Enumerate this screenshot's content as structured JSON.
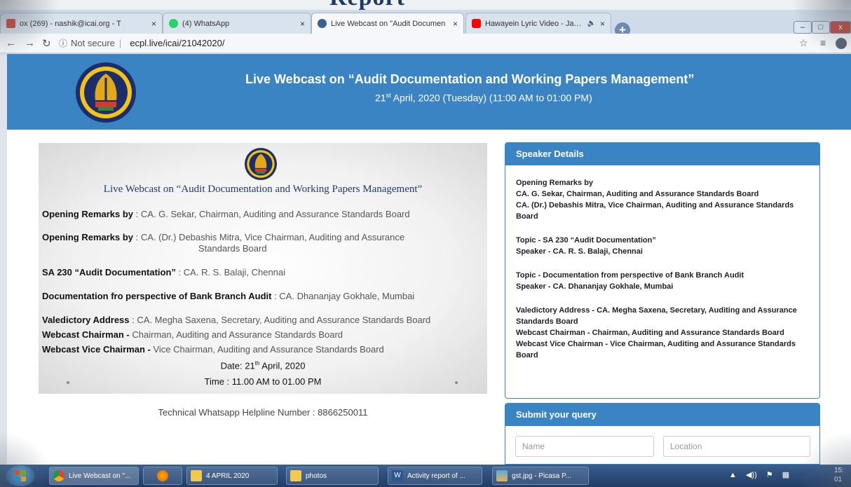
{
  "top_caption": "Report",
  "tabs": [
    {
      "label": "ox (269) - nashik@icai.org - T",
      "color": "#d44638"
    },
    {
      "label": "(4) WhatsApp",
      "color": "#25d366"
    },
    {
      "label": "Live Webcast on \"Audit Documen",
      "color": "#3b5f8f"
    },
    {
      "label": "Hawayein Lyric Video - Jab H",
      "color": "#ff0000"
    }
  ],
  "tab_close": "×",
  "browser": {
    "security": "Not secure",
    "url": "ecpl.live/icai/21042020/"
  },
  "header": {
    "title": "Live Webcast on “Audit Documentation and Working Papers Management”",
    "date_day": "21",
    "date_sup": "st",
    "date_rest": " April, 2020 (Tuesday) (11:00 AM to 01:00 PM)"
  },
  "poster": {
    "title": "Live Webcast on “Audit Documentation and Working Papers Management”",
    "lines": [
      {
        "label": "Opening Remarks by",
        "sep": " : ",
        "text": "CA. G. Sekar, Chairman, Auditing and Assurance Standards Board"
      },
      {
        "label": "Opening Remarks by",
        "sep": " : ",
        "text": "CA. (Dr.) Debashis Mitra, Vice Chairman, Auditing and Assurance",
        "text2": "Standards Board"
      },
      {
        "label": "SA 230 “Audit Documentation”",
        "sep": " : ",
        "text": "CA. R. S. Balaji, Chennai"
      },
      {
        "label": "Documentation fro perspective of Bank Branch Audit",
        "sep": " : ",
        "text": "CA. Dhananjay Gokhale, Mumbai"
      },
      {
        "label": "Valedictory Address",
        "sep": " : ",
        "text": "CA. Megha Saxena, Secretary, Auditing and Assurance Standards Board"
      },
      {
        "label": "Webcast Chairman -",
        "sep": " ",
        "text": "Chairman, Auditing and Assurance Standards Board"
      },
      {
        "label": "Webcast Vice Chairman -",
        "sep": " ",
        "text": "Vice Chairman, Auditing and Assurance Standards Board"
      }
    ],
    "date_prefix": "Date: 21",
    "date_sup": "th",
    "date_suffix": " April, 2020",
    "time": "Time : 11.00 AM to 01.00 PM"
  },
  "helpline": "Technical Whatsapp Helpline Number : 8866250011",
  "speaker_panel": {
    "heading": "Speaker Details",
    "blocks": [
      [
        "Opening Remarks by",
        "CA. G. Sekar, Chairman, Auditing and Assurance Standards Board",
        "CA. (Dr.) Debashis Mitra, Vice Chairman, Auditing and Assurance Standards Board"
      ],
      [
        "Topic - SA 230 “Audit Documentation”",
        "Speaker - CA. R. S. Balaji, Chennai"
      ],
      [
        "Topic - Documentation from perspective of Bank Branch Audit",
        "Speaker - CA. Dhananjay Gokhale, Mumbai"
      ],
      [
        "Valedictory Address - CA. Megha Saxena, Secretary, Auditing and Assurance Standards Board",
        "Webcast Chairman - Chairman, Auditing and Assurance Standards Board",
        "Webcast Vice Chairman - Vice Chairman, Auditing and Assurance Standards Board"
      ]
    ]
  },
  "query_panel": {
    "heading": "Submit your query",
    "name_placeholder": "Name",
    "location_placeholder": "Location"
  },
  "taskbar": {
    "items": [
      {
        "label": "Live Webcast on \"...",
        "icon": "chrome-icon"
      },
      {
        "label": "",
        "icon": "firefox-icon"
      },
      {
        "label": "4 APRIL 2020",
        "icon": "folder-icon"
      },
      {
        "label": "photos",
        "icon": "folder-icon"
      },
      {
        "label": "Activity report of ...",
        "icon": "word-icon"
      },
      {
        "label": "gst.jpg - Picasa P...",
        "icon": "picasa-icon"
      }
    ],
    "clock_time": "15:",
    "clock_date": "01"
  },
  "colors": {
    "accent": "#3b84c3",
    "taskbar": "#1f3c66"
  }
}
